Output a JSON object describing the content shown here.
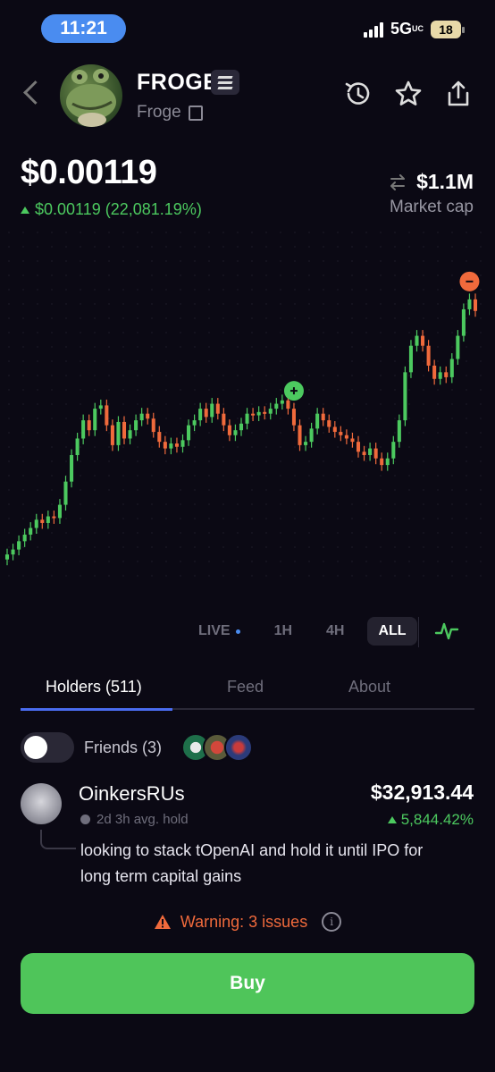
{
  "status_bar": {
    "time": "11:21",
    "network": "5G",
    "network_suffix": "UC",
    "battery": "18"
  },
  "token": {
    "name": "FROGE",
    "subname": "Froge"
  },
  "price": {
    "value": "$0.00119",
    "change": "$0.00119 (22,081.19%)",
    "market_cap": "$1.1M",
    "market_cap_label": "Market cap"
  },
  "ranges": {
    "live": "LIVE",
    "h1": "1H",
    "h4": "4H",
    "all": "ALL",
    "selected": "ALL"
  },
  "tabs": [
    {
      "label": "Holders (511)",
      "active": true
    },
    {
      "label": "Feed",
      "active": false
    },
    {
      "label": "About",
      "active": false
    }
  ],
  "friends": {
    "label": "Friends (3)",
    "enabled": false
  },
  "holder": {
    "name": "OinkersRUs",
    "hold_time": "2d 3h avg. hold",
    "value": "$32,913.44",
    "pct": "5,844.42%",
    "comment": "looking to stack tOpenAI and hold it until IPO for long term capital gains"
  },
  "warning": {
    "text": "Warning: 3 issues"
  },
  "buy_label": "Buy",
  "colors": {
    "up": "#4cc95f",
    "down": "#f06a3c",
    "accent": "#4a8cf0",
    "buy": "#4fc55a"
  },
  "chart_data": {
    "type": "candlestick",
    "series": [
      {
        "o": 0.5,
        "c": 0.8
      },
      {
        "o": 0.8,
        "c": 1.1
      },
      {
        "o": 1.1,
        "c": 1.6
      },
      {
        "o": 1.6,
        "c": 2.0
      },
      {
        "o": 2.0,
        "c": 2.4
      },
      {
        "o": 2.4,
        "c": 2.9
      },
      {
        "o": 2.9,
        "c": 2.7
      },
      {
        "o": 2.7,
        "c": 3.1
      },
      {
        "o": 3.1,
        "c": 3.0
      },
      {
        "o": 3.0,
        "c": 3.8
      },
      {
        "o": 3.8,
        "c": 5.2
      },
      {
        "o": 5.2,
        "c": 6.8
      },
      {
        "o": 6.8,
        "c": 7.8
      },
      {
        "o": 7.8,
        "c": 8.9
      },
      {
        "o": 8.9,
        "c": 8.3
      },
      {
        "o": 8.3,
        "c": 9.6
      },
      {
        "o": 9.6,
        "c": 9.8
      },
      {
        "o": 9.8,
        "c": 8.6
      },
      {
        "o": 8.6,
        "c": 7.4
      },
      {
        "o": 7.4,
        "c": 8.8
      },
      {
        "o": 8.8,
        "c": 7.8
      },
      {
        "o": 7.8,
        "c": 8.3
      },
      {
        "o": 8.3,
        "c": 8.9
      },
      {
        "o": 8.9,
        "c": 9.3
      },
      {
        "o": 9.3,
        "c": 9.0
      },
      {
        "o": 9.0,
        "c": 8.2
      },
      {
        "o": 8.2,
        "c": 7.6
      },
      {
        "o": 7.6,
        "c": 7.2
      },
      {
        "o": 7.2,
        "c": 7.5
      },
      {
        "o": 7.5,
        "c": 7.3
      },
      {
        "o": 7.3,
        "c": 7.7
      },
      {
        "o": 7.7,
        "c": 8.6
      },
      {
        "o": 8.6,
        "c": 8.9
      },
      {
        "o": 8.9,
        "c": 9.6
      },
      {
        "o": 9.6,
        "c": 9.1
      },
      {
        "o": 9.1,
        "c": 9.9
      },
      {
        "o": 9.9,
        "c": 9.3
      },
      {
        "o": 9.3,
        "c": 8.6
      },
      {
        "o": 8.6,
        "c": 8.0
      },
      {
        "o": 8.0,
        "c": 8.3
      },
      {
        "o": 8.3,
        "c": 8.7
      },
      {
        "o": 8.7,
        "c": 9.3
      },
      {
        "o": 9.3,
        "c": 9.2
      },
      {
        "o": 9.2,
        "c": 9.4
      },
      {
        "o": 9.4,
        "c": 9.3
      },
      {
        "o": 9.3,
        "c": 9.6
      },
      {
        "o": 9.6,
        "c": 9.9
      },
      {
        "o": 9.9,
        "c": 10.1
      },
      {
        "o": 10.1,
        "c": 9.6
      },
      {
        "o": 9.6,
        "c": 8.6
      },
      {
        "o": 8.6,
        "c": 7.4
      },
      {
        "o": 7.4,
        "c": 7.6
      },
      {
        "o": 7.6,
        "c": 8.4
      },
      {
        "o": 8.4,
        "c": 9.3
      },
      {
        "o": 9.3,
        "c": 8.9
      },
      {
        "o": 8.9,
        "c": 8.5
      },
      {
        "o": 8.5,
        "c": 8.2
      },
      {
        "o": 8.2,
        "c": 8.0
      },
      {
        "o": 8.0,
        "c": 7.8
      },
      {
        "o": 7.8,
        "c": 7.6
      },
      {
        "o": 7.6,
        "c": 7.0
      },
      {
        "o": 7.0,
        "c": 6.8
      },
      {
        "o": 6.8,
        "c": 7.2
      },
      {
        "o": 7.2,
        "c": 6.6
      },
      {
        "o": 6.6,
        "c": 6.2
      },
      {
        "o": 6.2,
        "c": 6.6
      },
      {
        "o": 6.6,
        "c": 7.6
      },
      {
        "o": 7.6,
        "c": 8.9
      },
      {
        "o": 8.9,
        "c": 11.8
      },
      {
        "o": 11.8,
        "c": 13.4
      },
      {
        "o": 13.4,
        "c": 14.0
      },
      {
        "o": 14.0,
        "c": 13.4
      },
      {
        "o": 13.4,
        "c": 12.2
      },
      {
        "o": 12.2,
        "c": 11.4
      },
      {
        "o": 11.4,
        "c": 11.8
      },
      {
        "o": 11.8,
        "c": 11.5
      },
      {
        "o": 11.5,
        "c": 12.6
      },
      {
        "o": 12.6,
        "c": 14.0
      },
      {
        "o": 14.0,
        "c": 15.6
      },
      {
        "o": 15.6,
        "c": 16.2
      },
      {
        "o": 16.2,
        "c": 15.5
      }
    ],
    "markers": [
      {
        "index": 49,
        "type": "buy"
      },
      {
        "index": 79,
        "type": "sell"
      }
    ],
    "grid": "dots"
  }
}
